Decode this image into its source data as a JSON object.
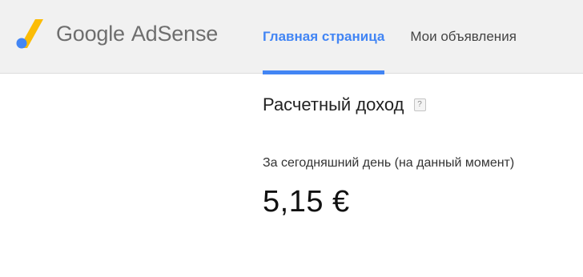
{
  "brand": {
    "google": "Google",
    "product": "AdSense"
  },
  "nav": {
    "tabs": [
      {
        "label": "Главная страница",
        "active": true
      },
      {
        "label": "Мои объявления",
        "active": false
      }
    ]
  },
  "earnings": {
    "title": "Расчетный доход",
    "help_icon": "?",
    "period": "За сегодняшний день (на данный момент)",
    "amount": "5,15 €"
  },
  "colors": {
    "accent": "#4285f4",
    "logo_yellow": "#fbbc05",
    "logo_blue": "#4285f4",
    "header_bg": "#f1f1f1"
  }
}
